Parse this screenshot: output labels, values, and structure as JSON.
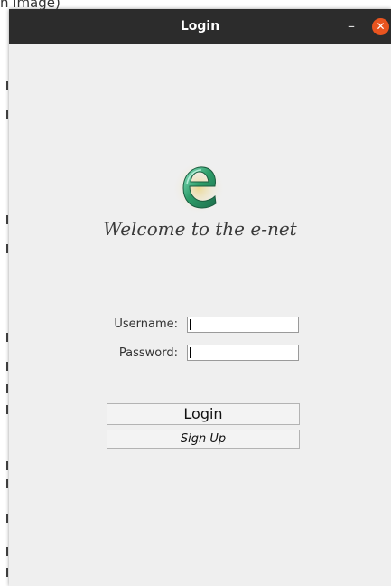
{
  "background": {
    "caption": "n image)"
  },
  "window": {
    "title": "Login",
    "minimize_glyph": "–",
    "close_glyph": "✕"
  },
  "logo": {
    "icon": "e-logo-icon",
    "letter": "e",
    "colors": {
      "primary": "#2e9e6a",
      "highlight": "#5fd3b0",
      "accent": "#d8a020"
    }
  },
  "welcome_text": "Welcome to the e-net",
  "form": {
    "username_label": "Username:",
    "username_value": "",
    "password_label": "Password:",
    "password_value": ""
  },
  "buttons": {
    "login_label": "Login",
    "signup_label": "Sign Up"
  },
  "colors": {
    "titlebar": "#2c2c2c",
    "window_bg": "#efefef",
    "close_button": "#e9541f"
  }
}
